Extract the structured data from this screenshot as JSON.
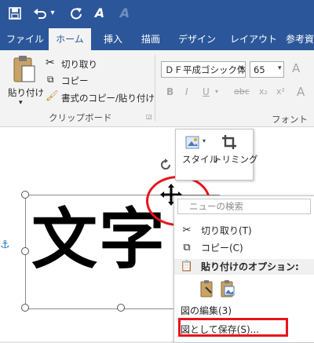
{
  "qat": {
    "save_icon": "save-icon",
    "undo_icon": "undo-icon",
    "undo_dropdown": "▾",
    "redo_icon": "repeat-icon",
    "format_icon": "text-effect-icon",
    "disabled_icon": "text-effect-disabled-icon"
  },
  "tabs": [
    "ファイル",
    "ホーム",
    "挿入",
    "描画",
    "デザイン",
    "レイアウト",
    "参考資"
  ],
  "ribbon": {
    "paste_label": "貼り付け",
    "paste_arrow": "▾",
    "cut_label": "切り取り",
    "copy_label": "コピー",
    "format_painter_label": "書式のコピー/貼り付け",
    "clipboard_group": "クリップボード",
    "font_name": "ＤＦ平成ゴシック体",
    "font_size": "65",
    "font_group": "フォント",
    "bold": "B",
    "italic": "I",
    "underline": "U",
    "strike": "abc",
    "sub": "x₂",
    "sup": "x²",
    "grow": "A",
    "clear": "A"
  },
  "document": {
    "text": "文字"
  },
  "mini_toolbar": {
    "style_label": "スタイル",
    "crop_label": "トリミング"
  },
  "context_menu": {
    "search_placeholder": "ニューの検索",
    "items": {
      "cut": "切り取り(T)",
      "copy": "コピー(C)",
      "paste_options": "貼り付けのオプション:",
      "edit_picture": "図の編集(3)",
      "save_as_picture": "図として保存(S)..."
    }
  },
  "colors": {
    "accent": "#2b579a",
    "highlight_red": "#e8141c"
  }
}
